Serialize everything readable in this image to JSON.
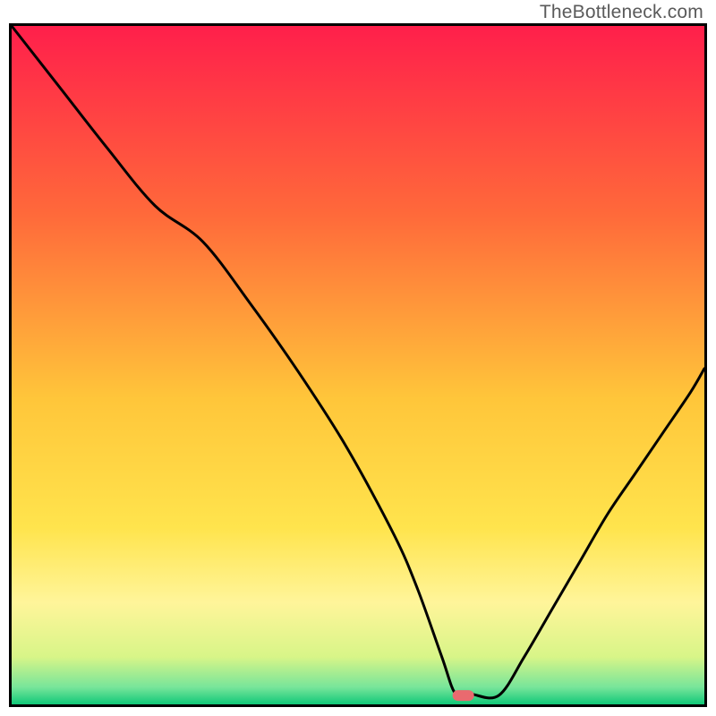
{
  "watermark": "TheBottleneck.com",
  "chart_data": {
    "type": "line",
    "title": "",
    "xlabel": "",
    "ylabel": "",
    "xlim": [
      0,
      100
    ],
    "ylim": [
      0,
      100
    ],
    "grid": false,
    "legend": false,
    "gradient_stops": [
      {
        "offset": 0.0,
        "color": "#ff1f4b"
      },
      {
        "offset": 0.28,
        "color": "#ff6a3a"
      },
      {
        "offset": 0.55,
        "color": "#ffc63a"
      },
      {
        "offset": 0.74,
        "color": "#ffe44d"
      },
      {
        "offset": 0.85,
        "color": "#fff59a"
      },
      {
        "offset": 0.93,
        "color": "#d8f588"
      },
      {
        "offset": 0.975,
        "color": "#77e59a"
      },
      {
        "offset": 1.0,
        "color": "#10c878"
      }
    ],
    "x": [
      0.0,
      6.9,
      13.8,
      20.7,
      27.6,
      34.5,
      41.4,
      48.3,
      55.2,
      58.6,
      62.1,
      64.1,
      66.3,
      70.3,
      74.0,
      78.0,
      82.0,
      86.0,
      90.0,
      94.0,
      98.0,
      100.0
    ],
    "y": [
      100.0,
      91.0,
      82.0,
      73.5,
      68.2,
      59.0,
      49.0,
      38.0,
      25.0,
      17.0,
      7.0,
      1.5,
      1.5,
      1.3,
      7.0,
      14.0,
      21.0,
      28.0,
      34.0,
      40.0,
      46.0,
      49.5
    ],
    "optimum_marker": {
      "x": 65.2,
      "y": 1.3
    }
  }
}
